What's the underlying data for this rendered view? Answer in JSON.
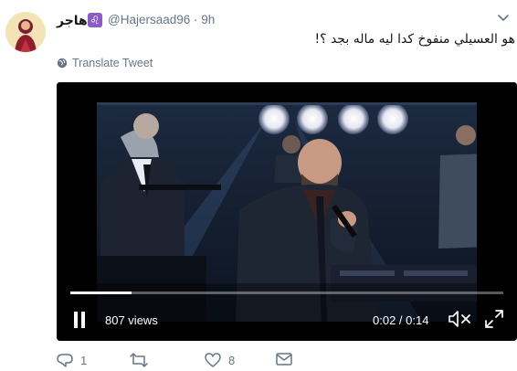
{
  "tweet": {
    "display_name": "هاجر",
    "handle": "@Hajersaad96",
    "separator": "·",
    "time_ago": "9h",
    "text": "هو العسيلي منفوخ كدا ليه ماله بجد ؟!",
    "translate_label": "Translate Tweet",
    "zodiac_icon": "leo-badge-icon"
  },
  "video": {
    "views": "807 views",
    "current_time": "0:02",
    "duration": "0:14",
    "progress": 0.142
  },
  "actions": {
    "reply_count": "1",
    "retweet_count": "",
    "like_count": "8"
  },
  "colors": {
    "text": "#14171a",
    "secondary": "#657786",
    "video_bg": "#000000",
    "zodiac_badge": "#8d5bc5"
  }
}
